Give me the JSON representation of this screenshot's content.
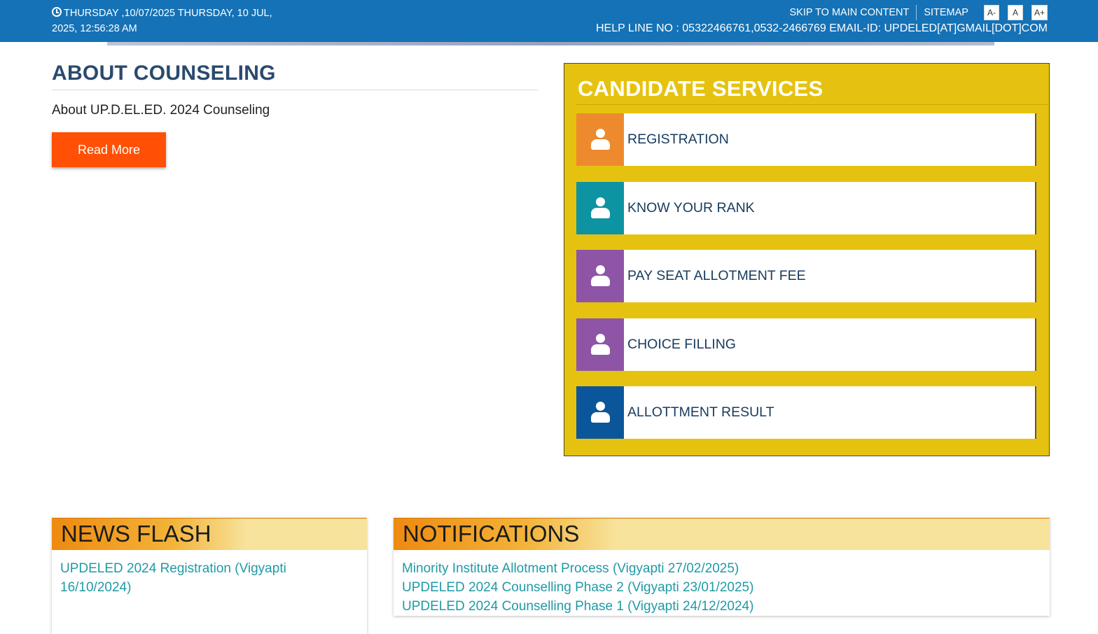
{
  "header": {
    "datetime_line1": "THURSDAY ,10/07/2025 THURSDAY, 10 JUL,",
    "datetime_line2": "2025, 12:56:28 AM",
    "skip_link": "SKIP TO MAIN CONTENT",
    "sitemap_link": "SITEMAP",
    "font_decrease": "A-",
    "font_normal": "A",
    "font_increase": "A+",
    "helpline": "HELP LINE NO : 05322466761,0532-2466769 EMAIL-ID: UPDELED[AT]GMAIL[DOT]COM"
  },
  "about": {
    "title": "ABOUT COUNSELING",
    "text": "About UP.D.EL.ED. 2024 Counseling",
    "read_more": "Read More"
  },
  "services": {
    "title": "CANDIDATE SERVICES",
    "items": [
      {
        "label": "REGISTRATION",
        "icon": "user-icon",
        "color": "#ee8a2e"
      },
      {
        "label": "KNOW YOUR RANK",
        "icon": "user-icon",
        "color": "#0e93a3"
      },
      {
        "label": "PAY SEAT ALLOTMENT FEE",
        "icon": "user-icon",
        "color": "#8e55a6"
      },
      {
        "label": "CHOICE FILLING",
        "icon": "user-icon",
        "color": "#8e55a6"
      },
      {
        "label": "ALLOTTMENT RESULT",
        "icon": "user-icon",
        "color": "#0b569a"
      }
    ]
  },
  "news": {
    "title": "NEWS FLASH",
    "items": [
      "UPDELED 2024 Registration (Vigyapti 16/10/2024)"
    ]
  },
  "notifications": {
    "title": "NOTIFICATIONS",
    "items": [
      "Minority Institute Allotment Process (Vigyapti 27/02/2025)",
      "UPDELED 2024 Counselling Phase 2 (Vigyapti 23/01/2025)",
      "UPDELED 2024 Counselling Phase 1 (Vigyapti 24/12/2024)"
    ]
  },
  "colors": {
    "topbar": "#1572b6",
    "services_bg": "#e6c210",
    "read_more": "#ff5005",
    "link": "#1f9aa6"
  }
}
